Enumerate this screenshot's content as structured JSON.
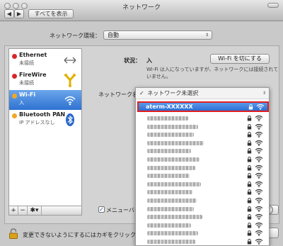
{
  "window": {
    "title": "ネットワーク"
  },
  "toolbar": {
    "back": "◀",
    "forward": "▶",
    "show_all": "すべてを表示"
  },
  "location": {
    "label": "ネットワーク環境：",
    "value": "自動",
    "arrow": "⇕"
  },
  "services": [
    {
      "name": "Ethernet",
      "status": "未接続",
      "dot_color": "#d9252a",
      "icon": "ethernet-arrows-icon"
    },
    {
      "name": "FireWire",
      "status": "未接続",
      "dot_color": "#d9252a",
      "icon": "firewire-icon"
    },
    {
      "name": "Wi-Fi",
      "status": "入",
      "dot_color": "#f5a623",
      "icon": "wifi-icon",
      "selected": true
    },
    {
      "name": "Bluetooth PAN",
      "status": "IP アドレスなし",
      "dot_color": "#f5a623",
      "icon": "bluetooth-icon"
    }
  ],
  "sidebar_buttons": {
    "add": "+",
    "remove": "−",
    "gear": "✱▾"
  },
  "detail": {
    "status_label": "状況：",
    "status_value": "入",
    "status_desc": "Wi-Fi は入になっていますが、ネットワークには接続されていません。",
    "wifi_off_button": "Wi-Fi を切にする",
    "network_name_label": "ネットワーク名："
  },
  "dropdown": {
    "header_check": "✓",
    "header_text": "ネットワーク未選択",
    "selected_network": "aterm-XXXXXX",
    "selected_border_color": "#e02020",
    "blurred_rows": 16
  },
  "menubar_checkbox": {
    "checked": true,
    "label": "メニューバーに"
  },
  "help": "?",
  "lock": {
    "text": "変更できないようにするにはカギをクリックします。"
  },
  "colors": {
    "selection_blue": "#2e72d2",
    "red_dot": "#d9252a",
    "yellow_dot": "#f5a623"
  }
}
